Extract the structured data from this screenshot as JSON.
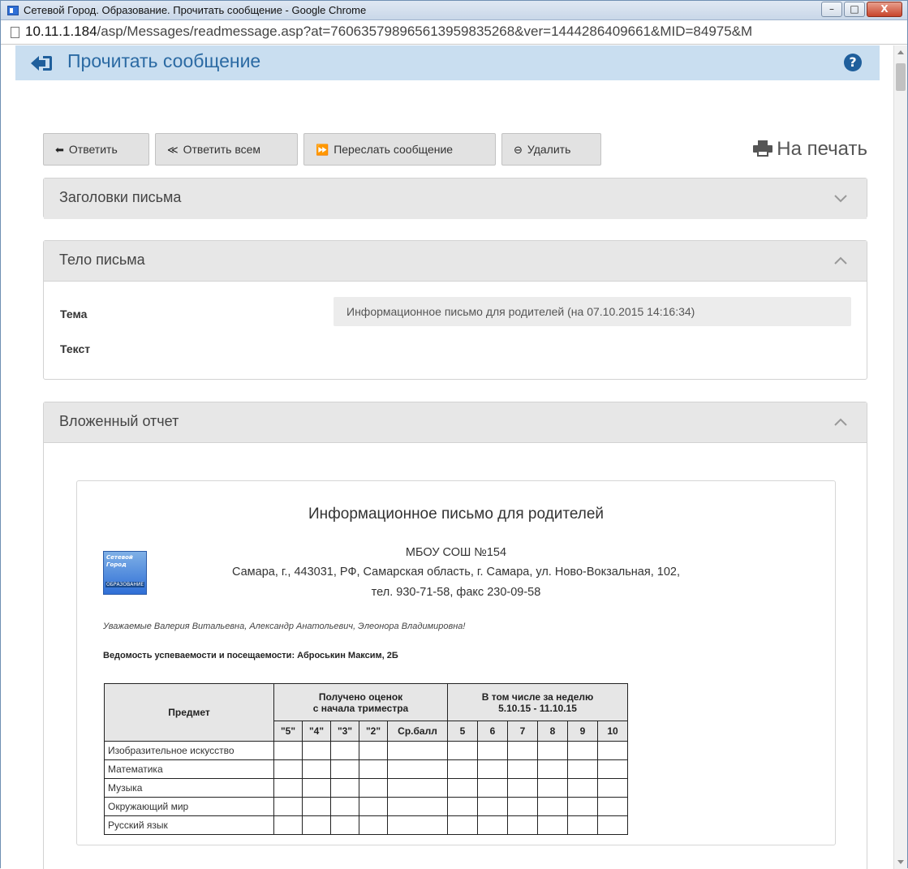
{
  "window": {
    "title": "Сетевой Город. Образование. Прочитать сообщение - Google Chrome",
    "url_host": "10.11.1.184",
    "url_path": "/asp/Messages/readmessage.asp?at=760635798965613959835268&ver=1444286409661&MID=84975&M"
  },
  "header": {
    "title": "Прочитать сообщение",
    "help": "?"
  },
  "toolbar": {
    "reply_label": "Ответить",
    "reply_all_label": "Ответить всем",
    "forward_label": "Переслать сообщение",
    "delete_label": "Удалить",
    "print_label": "На печать"
  },
  "panels": {
    "headers_title": "Заголовки письма",
    "body_title": "Тело письма",
    "report_title": "Вложенный отчет"
  },
  "message": {
    "subject_label": "Тема",
    "subject_value": "Информационное письмо для родителей (на 07.10.2015 14:16:34)",
    "text_label": "Текст"
  },
  "report": {
    "title": "Информационное письмо для родителей",
    "school_name": "МБОУ СОШ №154",
    "address": "Самара, г., 443031, РФ, Самарская область, г. Самара, ул. Ново-Вокзальная, 102,",
    "phone": "тел. 930-71-58, факс 230-09-58",
    "logo_text_1": "Сетевой",
    "logo_text_2": "Город",
    "logo_text_3": "ОБРАЗОВАНИЕ",
    "greeting": "Уважаемые Валерия Витальевна, Александр Анатольевич, Элеонора Владимировна!",
    "sheet_title": "Ведомость успеваемости и посещаемости: Аброськин Максим, 2Б",
    "table": {
      "col_subject": "Предмет",
      "group1_line1": "Получено оценок",
      "group1_line2": "с начала триместра",
      "group2_line1": "В том числе за неделю",
      "group2_line2": "5.10.15 - 11.10.15",
      "grade_cols": [
        "\"5\"",
        "\"4\"",
        "\"3\"",
        "\"2\"",
        "Ср.балл"
      ],
      "week_cols": [
        "5",
        "6",
        "7",
        "8",
        "9",
        "10"
      ],
      "subjects": [
        "Изобразительное искусство",
        "Математика",
        "Музыка",
        "Окружающий мир",
        "Русский язык"
      ]
    }
  },
  "colors": {
    "header_bg": "#c9def0",
    "accent": "#2b6aa3",
    "button_bg": "#e2e2e2"
  },
  "icons": {
    "back": "sign-in-arrow-icon",
    "help": "question-circle-icon",
    "reply": "reply-icon",
    "reply_all": "reply-all-icon",
    "forward": "fast-forward-icon",
    "delete": "minus-circle-icon",
    "print": "printer-icon",
    "collapse": "chevron-up-icon",
    "expand": "chevron-down-icon"
  }
}
